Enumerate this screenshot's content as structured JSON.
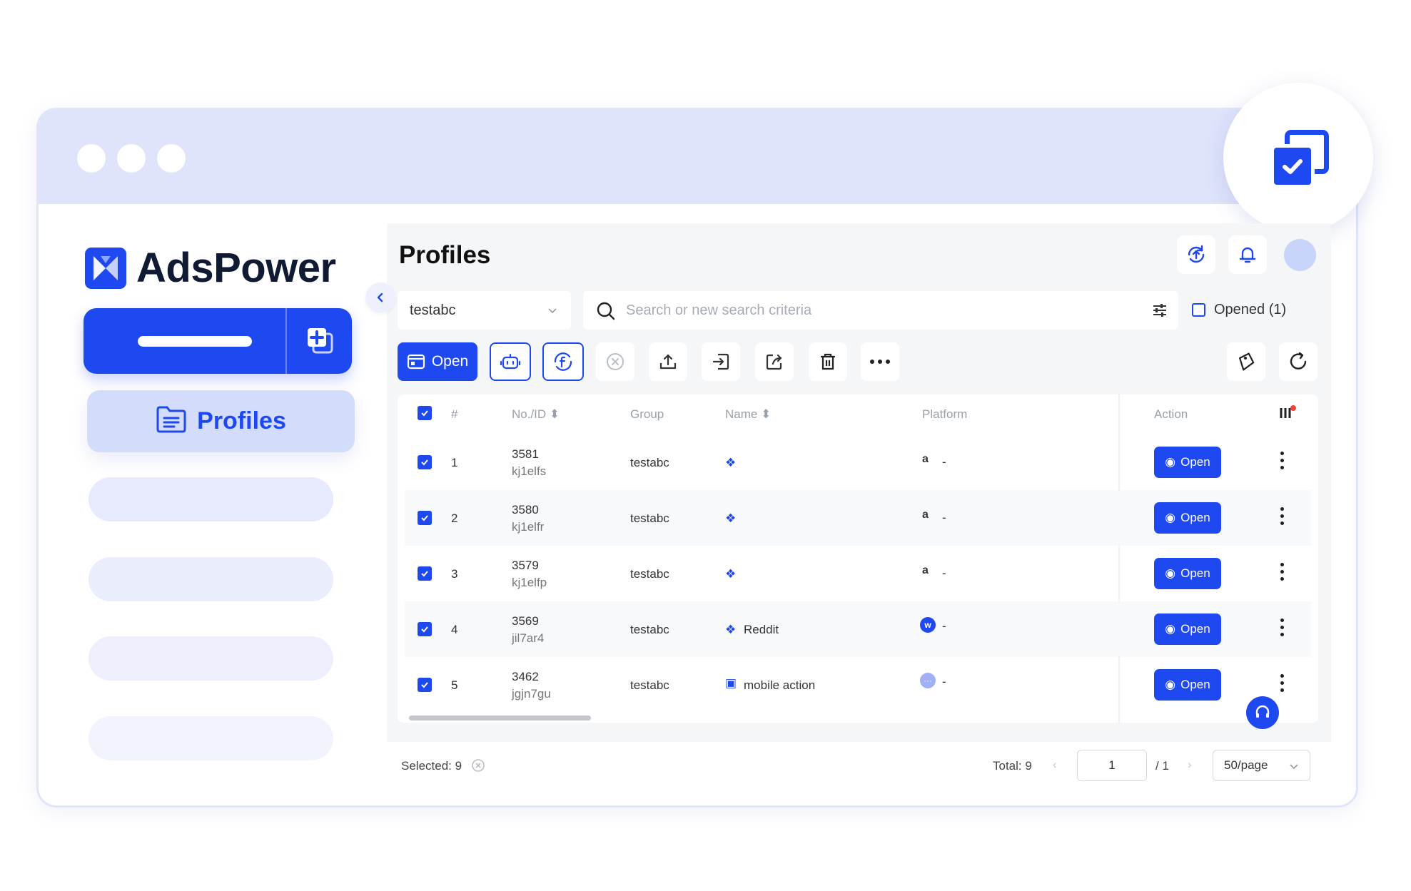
{
  "app": {
    "logo_text": "AdsPower"
  },
  "sidebar": {
    "nav_active_label": "Profiles"
  },
  "header": {
    "title": "Profiles"
  },
  "filters": {
    "group_value": "testabc",
    "search_placeholder": "Search or new search criteria",
    "opened_label": "Opened (1)"
  },
  "toolbar": {
    "open_label": "Open"
  },
  "table": {
    "columns": {
      "index": "#",
      "no_id": "No./ID",
      "group": "Group",
      "name": "Name",
      "platform": "Platform",
      "action": "Action"
    },
    "rows": [
      {
        "index": "1",
        "no": "3581",
        "id": "kj1elfs",
        "group": "testabc",
        "name": "",
        "name_icon": "windows-icon",
        "platform_icon": "amazon-icon",
        "platform_text": "-",
        "open_label": "Open"
      },
      {
        "index": "2",
        "no": "3580",
        "id": "kj1elfr",
        "group": "testabc",
        "name": "",
        "name_icon": "windows-icon",
        "platform_icon": "amazon-icon",
        "platform_text": "-",
        "open_label": "Open"
      },
      {
        "index": "3",
        "no": "3579",
        "id": "kj1elfp",
        "group": "testabc",
        "name": "",
        "name_icon": "windows-icon",
        "platform_icon": "amazon-icon",
        "platform_text": "-",
        "open_label": "Open"
      },
      {
        "index": "4",
        "no": "3569",
        "id": "jil7ar4",
        "group": "testabc",
        "name": "Reddit",
        "name_icon": "windows-icon",
        "platform_icon": "w-badge-icon",
        "platform_text": "-",
        "open_label": "Open"
      },
      {
        "index": "5",
        "no": "3462",
        "id": "jgjn7gu",
        "group": "testabc",
        "name": "mobile action",
        "name_icon": "android-icon",
        "platform_icon": "more-badge-icon",
        "platform_text": "-",
        "open_label": "Open"
      }
    ]
  },
  "footer": {
    "selected_label": "Selected: 9",
    "total_label": "Total: 9",
    "current_page": "1",
    "page_count_label": "/ 1",
    "page_size": "50/page"
  },
  "colors": {
    "accent": "#1f49f0",
    "titlebar": "#dfe4fb",
    "nav_active_bg": "#d3dcfa",
    "panel_bg": "#f5f6f8"
  }
}
